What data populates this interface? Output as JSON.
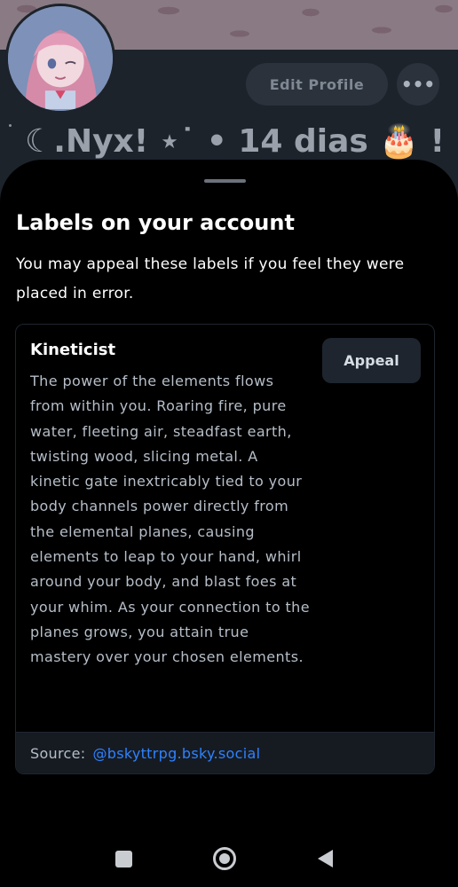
{
  "profile": {
    "edit_profile_label": "Edit Profile",
    "more_label": "•••",
    "display_name": "☾.Nyx! ⋆˙ • 14 dias 🎂 !"
  },
  "sheet": {
    "title": "Labels on your account",
    "subtitle": "You may appeal these labels if you feel they were placed in error."
  },
  "label": {
    "name": "Kineticist",
    "description": "The power of the elements flows from within you. Roaring fire, pure water, fleeting air, steadfast earth, twisting wood, slicing metal. A kinetic gate inextricably tied to your body channels power directly from the elemental planes, causing elements to leap to your hand, whirl around your body, and blast foes at your whim. As your connection to the planes grows, you attain true mastery over your chosen elements.",
    "appeal_label": "Appeal",
    "source_label": "Source:",
    "source_handle": "@bskyttrpg.bsky.social"
  },
  "colors": {
    "accent_link": "#2f82ff",
    "sheet_background": "#000000",
    "button_background": "#1e252e"
  },
  "icons": {
    "more": "horizontal-ellipsis",
    "nav_recents": "square",
    "nav_home": "circle",
    "nav_back": "triangle-left"
  }
}
